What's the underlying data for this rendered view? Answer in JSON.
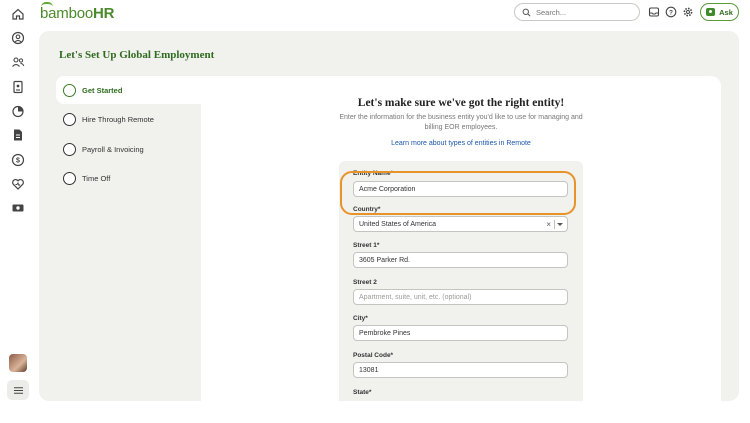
{
  "app": {
    "logo_prefix": "bamboo",
    "logo_suffix": "HR"
  },
  "header": {
    "search_placeholder": "Search...",
    "ask_label": "Ask",
    "icons": [
      "inbox-icon",
      "help-icon",
      "settings-icon"
    ]
  },
  "rail": {
    "icons": [
      "home-icon",
      "person-icon",
      "people-icon",
      "id-card-icon",
      "pie-chart-icon",
      "document-icon",
      "dollar-icon",
      "heart-icon",
      "money-icon",
      "menu-icon"
    ]
  },
  "page": {
    "title": "Let's Set Up Global Employment"
  },
  "steps": [
    {
      "label": "Get Started",
      "active": true
    },
    {
      "label": "Hire Through Remote",
      "active": false
    },
    {
      "label": "Payroll & Invoicing",
      "active": false
    },
    {
      "label": "Time Off",
      "active": false
    }
  ],
  "content": {
    "heading": "Let's make sure we've got the right entity!",
    "subtitle": "Enter the information for the business entity you'd like to use for managing and billing EOR employees.",
    "learn_more": "Learn more about types of entities in Remote"
  },
  "form": {
    "entity_name": {
      "label": "Entity Name*",
      "value": "Acme Corporation"
    },
    "country": {
      "label": "Country*",
      "value": "United States of America"
    },
    "street1": {
      "label": "Street 1*",
      "value": "3605 Parker Rd."
    },
    "street2": {
      "label": "Street 2",
      "placeholder": "Apartment, suite, unit, etc. (optional)"
    },
    "city": {
      "label": "City*",
      "value": "Pembroke Pines"
    },
    "postal_code": {
      "label": "Postal Code*",
      "value": "13081"
    }
  },
  "colors": {
    "brand_green": "#2f6b1f",
    "highlight": "#e8922a",
    "link": "#1a56a8"
  }
}
